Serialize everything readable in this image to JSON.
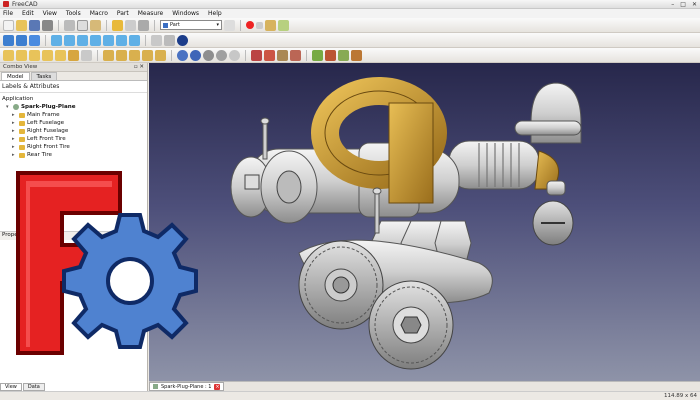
{
  "window": {
    "title": "FreeCAD"
  },
  "menu": [
    "File",
    "Edit",
    "View",
    "Tools",
    "Macro",
    "Part",
    "Measure",
    "Windows",
    "Help"
  ],
  "toolbar": {
    "workbench_selected": "Part"
  },
  "combo_view": {
    "title": "Combo View",
    "tabs": [
      "Model",
      "Tasks"
    ],
    "labels_header": "Labels & Attributes",
    "application_label": "Application",
    "tree": {
      "root": "Spark-Plug-Plane",
      "items": [
        "Main Frame",
        "Left Fuselage",
        "Right Fuselage",
        "Left Front Tire",
        "Right Front Tire",
        "Rear Tire"
      ]
    },
    "property_header": "Property",
    "bottom_tabs": [
      "View",
      "Data"
    ]
  },
  "document_tab": {
    "label": "Spark-Plug-Plane : 1"
  },
  "status": {
    "dimensions": "114.89 x 64"
  },
  "colors": {
    "viewport_top": "#27274b",
    "viewport_bottom": "#8e93a8",
    "logo_red": "#e52222",
    "logo_blue": "#4f82d0",
    "gold": "#c9982e"
  }
}
